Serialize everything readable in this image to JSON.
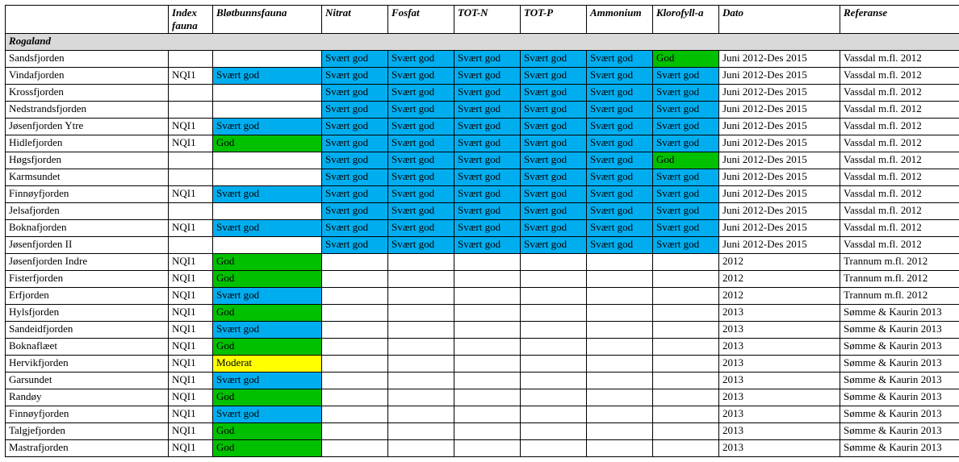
{
  "headers": {
    "name": "",
    "index": "Index fauna",
    "fauna": "Bløtbunnsfauna",
    "p0": "Nitrat",
    "p1": "Fosfat",
    "p2": "TOT-N",
    "p3": "TOT-P",
    "p4": "Ammonium",
    "p5": "Klorofyll-a",
    "dato": "Dato",
    "ref": "Referanse"
  },
  "region": "Rogaland",
  "labels": {
    "svg": "Svært god",
    "god": "God",
    "mod": "Moderat"
  },
  "rows": [
    {
      "name": "Sandsfjorden",
      "index": "",
      "fauna": "",
      "p": [
        "svg",
        "svg",
        "svg",
        "svg",
        "svg",
        "god"
      ],
      "dato": "Juni 2012-Des 2015",
      "ref": "Vassdal m.fl. 2012"
    },
    {
      "name": "Vindafjorden",
      "index": "NQI1",
      "fauna": "svg",
      "p": [
        "svg",
        "svg",
        "svg",
        "svg",
        "svg",
        "svg"
      ],
      "dato": "Juni 2012-Des 2015",
      "ref": "Vassdal m.fl. 2012"
    },
    {
      "name": "Krossfjorden",
      "index": "",
      "fauna": "",
      "p": [
        "svg",
        "svg",
        "svg",
        "svg",
        "svg",
        "svg"
      ],
      "dato": "Juni 2012-Des 2015",
      "ref": "Vassdal m.fl. 2012"
    },
    {
      "name": "Nedstrandsfjorden",
      "index": "",
      "fauna": "",
      "p": [
        "svg",
        "svg",
        "svg",
        "svg",
        "svg",
        "svg"
      ],
      "dato": "Juni 2012-Des 2015",
      "ref": "Vassdal m.fl. 2012"
    },
    {
      "name": "Jøsenfjorden Ytre",
      "index": "NQI1",
      "fauna": "svg",
      "p": [
        "svg",
        "svg",
        "svg",
        "svg",
        "svg",
        "svg"
      ],
      "dato": "Juni 2012-Des 2015",
      "ref": "Vassdal m.fl. 2012"
    },
    {
      "name": "Hidlefjorden",
      "index": "NQI1",
      "fauna": "god",
      "p": [
        "svg",
        "svg",
        "svg",
        "svg",
        "svg",
        "svg"
      ],
      "dato": "Juni 2012-Des 2015",
      "ref": "Vassdal m.fl. 2012"
    },
    {
      "name": "Høgsfjorden",
      "index": "",
      "fauna": "",
      "p": [
        "svg",
        "svg",
        "svg",
        "svg",
        "svg",
        "god"
      ],
      "dato": "Juni 2012-Des 2015",
      "ref": "Vassdal m.fl. 2012"
    },
    {
      "name": "Karmsundet",
      "index": "",
      "fauna": "",
      "p": [
        "svg",
        "svg",
        "svg",
        "svg",
        "svg",
        "svg"
      ],
      "dato": "Juni 2012-Des 2015",
      "ref": "Vassdal m.fl. 2012"
    },
    {
      "name": "Finnøyfjorden",
      "index": "NQI1",
      "fauna": "svg",
      "p": [
        "svg",
        "svg",
        "svg",
        "svg",
        "svg",
        "svg"
      ],
      "dato": "Juni 2012-Des 2015",
      "ref": "Vassdal m.fl. 2012"
    },
    {
      "name": "Jelsafjorden",
      "index": "",
      "fauna": "",
      "p": [
        "svg",
        "svg",
        "svg",
        "svg",
        "svg",
        "svg"
      ],
      "dato": "Juni 2012-Des 2015",
      "ref": "Vassdal m.fl. 2012"
    },
    {
      "name": "Boknafjorden",
      "index": "NQI1",
      "fauna": "svg",
      "p": [
        "svg",
        "svg",
        "svg",
        "svg",
        "svg",
        "svg"
      ],
      "dato": "Juni 2012-Des 2015",
      "ref": "Vassdal m.fl. 2012"
    },
    {
      "name": "Jøsenfjorden II",
      "index": "",
      "fauna": "",
      "p": [
        "svg",
        "svg",
        "svg",
        "svg",
        "svg",
        "svg"
      ],
      "dato": "Juni 2012-Des 2015",
      "ref": "Vassdal m.fl. 2012"
    },
    {
      "name": "Jøsenfjorden Indre",
      "index": "NQI1",
      "fauna": "god",
      "p": [
        "",
        "",
        "",
        "",
        "",
        ""
      ],
      "dato": "2012",
      "ref": "Trannum m.fl. 2012"
    },
    {
      "name": "Fisterfjorden",
      "index": "NQI1",
      "fauna": "god",
      "p": [
        "",
        "",
        "",
        "",
        "",
        ""
      ],
      "dato": "2012",
      "ref": "Trannum m.fl. 2012"
    },
    {
      "name": "Erfjorden",
      "index": "NQI1",
      "fauna": "svg",
      "p": [
        "",
        "",
        "",
        "",
        "",
        ""
      ],
      "dato": "2012",
      "ref": "Trannum m.fl. 2012"
    },
    {
      "name": "Hylsfjorden",
      "index": "NQI1",
      "fauna": "god",
      "p": [
        "",
        "",
        "",
        "",
        "",
        ""
      ],
      "dato": "2013",
      "ref": "Sømme & Kaurin 2013"
    },
    {
      "name": "Sandeidfjorden",
      "index": "NQI1",
      "fauna": "svg",
      "p": [
        "",
        "",
        "",
        "",
        "",
        ""
      ],
      "dato": "2013",
      "ref": "Sømme & Kaurin 2013"
    },
    {
      "name": "Boknaflæet",
      "index": "NQI1",
      "fauna": "god",
      "p": [
        "",
        "",
        "",
        "",
        "",
        ""
      ],
      "dato": "2013",
      "ref": "Sømme & Kaurin 2013"
    },
    {
      "name": "Hervikfjorden",
      "index": "NQI1",
      "fauna": "mod",
      "p": [
        "",
        "",
        "",
        "",
        "",
        ""
      ],
      "dato": "2013",
      "ref": "Sømme & Kaurin 2013"
    },
    {
      "name": "Garsundet",
      "index": "NQI1",
      "fauna": "svg",
      "p": [
        "",
        "",
        "",
        "",
        "",
        ""
      ],
      "dato": "2013",
      "ref": "Sømme & Kaurin 2013"
    },
    {
      "name": "Randøy",
      "index": "NQI1",
      "fauna": "god",
      "p": [
        "",
        "",
        "",
        "",
        "",
        ""
      ],
      "dato": "2013",
      "ref": "Sømme & Kaurin 2013"
    },
    {
      "name": "Finnøyfjorden",
      "index": "NQI1",
      "fauna": "svg",
      "p": [
        "",
        "",
        "",
        "",
        "",
        ""
      ],
      "dato": "2013",
      "ref": "Sømme & Kaurin 2013"
    },
    {
      "name": "Talgjefjorden",
      "index": "NQI1",
      "fauna": "god",
      "p": [
        "",
        "",
        "",
        "",
        "",
        ""
      ],
      "dato": "2013",
      "ref": "Sømme & Kaurin 2013"
    },
    {
      "name": "Mastrafjorden",
      "index": "NQI1",
      "fauna": "god",
      "p": [
        "",
        "",
        "",
        "",
        "",
        ""
      ],
      "dato": "2013",
      "ref": "Sømme & Kaurin 2013"
    }
  ]
}
